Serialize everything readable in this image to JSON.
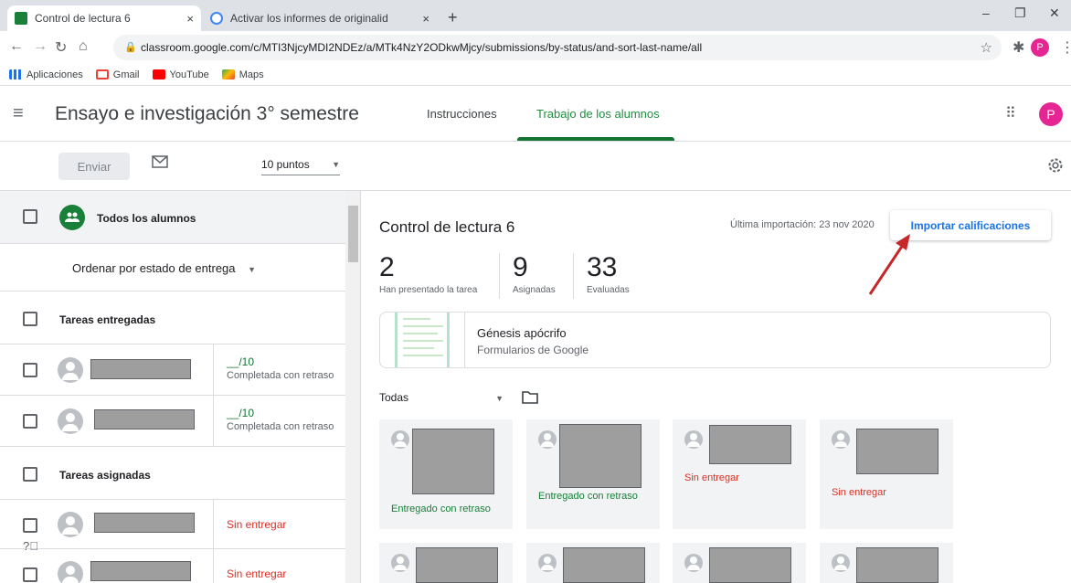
{
  "browser": {
    "tabs": [
      {
        "title": "Control de lectura 6",
        "active": true,
        "close": "×"
      },
      {
        "title": "Activar los informes de originalid",
        "active": false,
        "close": "×"
      }
    ],
    "new_tab": "+",
    "url": "classroom.google.com/c/MTI3NjcyMDI2NDEz/a/MTk4NzY2ODkwMjcy/submissions/by-status/and-sort-last-name/all",
    "bookmarks": [
      "Aplicaciones",
      "Gmail",
      "YouTube",
      "Maps"
    ],
    "profile_initial": "P"
  },
  "header": {
    "class_title": "Ensayo e investigación 3° semestre",
    "tabs": [
      "Instrucciones",
      "Trabajo de los alumnos"
    ],
    "active_tab": 1,
    "avatar_initial": "P"
  },
  "actions": {
    "send_label": "Enviar",
    "points_value": "10 puntos"
  },
  "left_panel": {
    "all_students": "Todos los alumnos",
    "sort_label": "Ordenar por estado de entrega",
    "sections": {
      "turned_in": "Tareas entregadas",
      "assigned": "Tareas asignadas"
    },
    "turned_in_students": [
      {
        "score": "__/10",
        "status": "Completada con retraso"
      },
      {
        "score": "__/10",
        "status": "Completada con retraso"
      }
    ],
    "assigned_students": [
      {
        "status": "Sin entregar"
      },
      {
        "status": "Sin entregar"
      }
    ]
  },
  "assignment": {
    "title": "Control de lectura 6",
    "last_import": "Última importación: 23 nov 2020",
    "import_button": "Importar calificaciones",
    "stats": [
      {
        "value": "2",
        "label": "Han presentado la tarea"
      },
      {
        "value": "9",
        "label": "Asignadas"
      },
      {
        "value": "33",
        "label": "Evaluadas"
      }
    ],
    "attachment": {
      "title": "Génesis apócrifo",
      "subtitle": "Formularios de Google"
    },
    "filter": "Todas",
    "cards": [
      {
        "status": "Entregado con retraso",
        "kind": "late"
      },
      {
        "status": "Entregado con retraso",
        "kind": "late"
      },
      {
        "status": "Sin entregar",
        "kind": "miss"
      },
      {
        "status": "Sin entregar",
        "kind": "miss"
      }
    ]
  },
  "colors": {
    "classroom_green": "#137333",
    "missing_red": "#d93025",
    "link_blue": "#1a73e8",
    "annotation_arrow": "#c62828"
  }
}
